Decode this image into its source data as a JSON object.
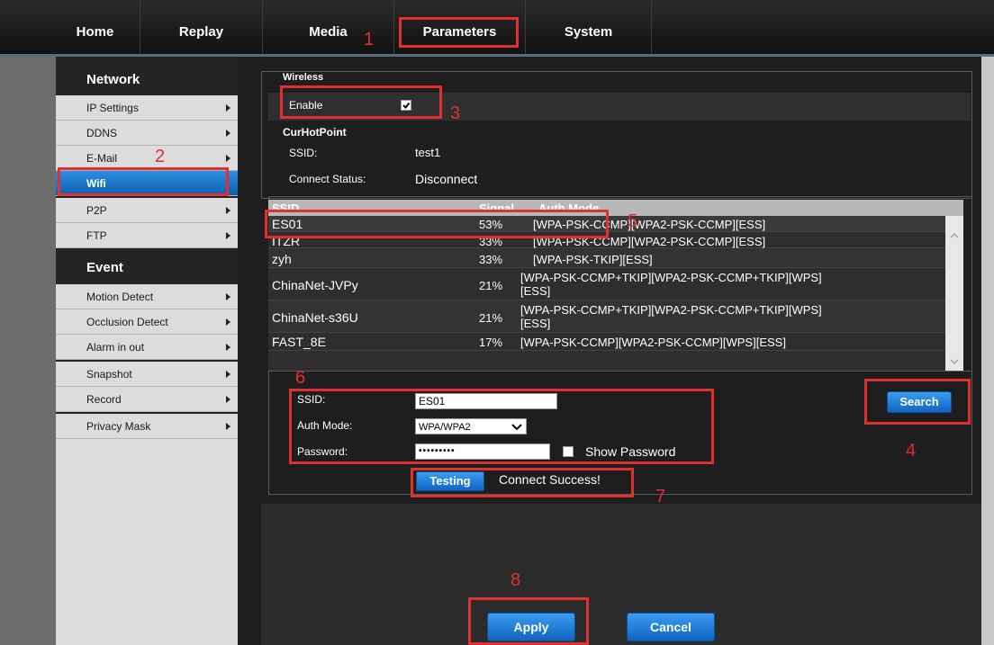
{
  "nav": {
    "items": [
      "Home",
      "Replay",
      "Media",
      "Parameters",
      "System"
    ]
  },
  "sidebar": {
    "network_header": "Network",
    "network_items": [
      "IP Settings",
      "DDNS",
      "E-Mail",
      "Wifi",
      "P2P",
      "FTP"
    ],
    "event_header": "Event",
    "event_items": [
      "Motion Detect",
      "Occlusion Detect",
      "Alarm in out",
      "Snapshot",
      "Record",
      "Privacy Mask"
    ],
    "active_item": "Wifi"
  },
  "wireless": {
    "section_label": "Wireless",
    "enable_label": "Enable",
    "enable_checked": true,
    "curhotpoint_label": "CurHotPoint",
    "ssid_label": "SSID:",
    "ssid_value": "test1",
    "connect_status_label": "Connect Status:",
    "connect_status_value": "Disconnect"
  },
  "table": {
    "columns": [
      "SSID",
      "Signal",
      "Auth Mode"
    ],
    "rows": [
      {
        "ssid": "ES01",
        "signal": "53%",
        "auth_lines": [
          "[WPA-PSK-CCMP][WPA2-PSK-CCMP][ESS]"
        ]
      },
      {
        "ssid": "ITZR",
        "signal": "33%",
        "auth_lines": [
          "[WPA-PSK-CCMP][WPA2-PSK-CCMP][ESS]"
        ]
      },
      {
        "ssid": "zyh",
        "signal": "33%",
        "auth_lines": [
          "[WPA-PSK-TKIP][ESS]"
        ]
      },
      {
        "ssid": "ChinaNet-JVPy",
        "signal": "21%",
        "auth_lines": [
          "[WPA-PSK-CCMP+TKIP][WPA2-PSK-CCMP+TKIP][WPS]",
          "[ESS]"
        ]
      },
      {
        "ssid": "ChinaNet-s36U",
        "signal": "21%",
        "auth_lines": [
          "[WPA-PSK-CCMP+TKIP][WPA2-PSK-CCMP+TKIP][WPS]",
          "[ESS]"
        ]
      },
      {
        "ssid": "FAST_8E",
        "signal": "17%",
        "auth_lines": [
          "[WPA-PSK-CCMP][WPA2-PSK-CCMP][WPS][ESS]"
        ]
      }
    ]
  },
  "form": {
    "ssid_label": "SSID:",
    "ssid_value": "ES01",
    "auth_label": "Auth Mode:",
    "auth_value": "WPA/WPA2",
    "password_label": "Password:",
    "password_value": "•••••••••",
    "show_password_label": "Show Password",
    "search_button": "Search",
    "testing_button": "Testing",
    "test_result": "Connect Success!"
  },
  "footer": {
    "apply_button": "Apply",
    "cancel_button": "Cancel"
  },
  "annotations": [
    "1",
    "2",
    "3",
    "4",
    "5",
    "6",
    "7",
    "8"
  ],
  "colors": {
    "accent_blue": "#1a75d0",
    "annotation_red": "#e03030"
  }
}
